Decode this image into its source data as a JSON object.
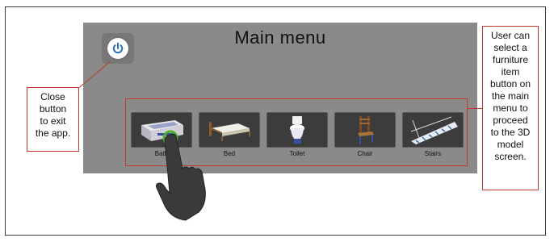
{
  "screen": {
    "title": "Main menu",
    "power_icon": "power-icon"
  },
  "menu_items": [
    {
      "label": "Bath",
      "icon": "bath-icon"
    },
    {
      "label": "Bed",
      "icon": "bed-icon"
    },
    {
      "label": "Toilet",
      "icon": "toilet-icon"
    },
    {
      "label": "Chair",
      "icon": "chair-icon"
    },
    {
      "label": "Stairs",
      "icon": "stairs-icon"
    }
  ],
  "annotations": {
    "close_callout": [
      "Close",
      "button",
      "to exit",
      "the app."
    ],
    "select_callout": [
      "User can",
      "select a",
      "furniture",
      "item",
      "button on",
      "the main",
      "menu to",
      "proceed",
      "to the 3D",
      "model",
      "screen."
    ]
  },
  "colors": {
    "screen_bg": "#8a8a8a",
    "callout_border": "#c0392b",
    "touch_highlight": "#4caf2a",
    "power_icon": "#2a6fb8"
  }
}
